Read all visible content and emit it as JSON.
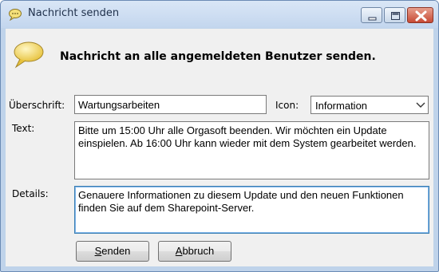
{
  "window": {
    "title": "Nachricht senden"
  },
  "header": {
    "heading": "Nachricht an alle angemeldeten Benutzer senden."
  },
  "form": {
    "subject_label": "Überschrift:",
    "subject_value": "Wartungsarbeiten",
    "icon_label": "Icon:",
    "icon_value": "Information",
    "text_label": "Text:",
    "text_value": "Bitte um 15:00 Uhr alle Orgasoft beenden. Wir möchten ein Update einspielen. Ab 16:00 Uhr kann wieder mit dem System gearbeitet werden.",
    "details_label": "Details:",
    "details_value": "Genauere Informationen zu diesem Update und den neuen Funktionen finden Sie auf dem Sharepoint-Server."
  },
  "buttons": {
    "send_rest": "enden",
    "send_key": "S",
    "cancel_rest": "bbruch",
    "cancel_key": "A"
  },
  "icons": {
    "window_icon": "speech-bubble-icon",
    "header_icon": "speech-bubble-icon"
  },
  "colors": {
    "titlebar": "#c8daf1",
    "close_button": "#c74a35",
    "focus_border": "#3c7fb1"
  }
}
